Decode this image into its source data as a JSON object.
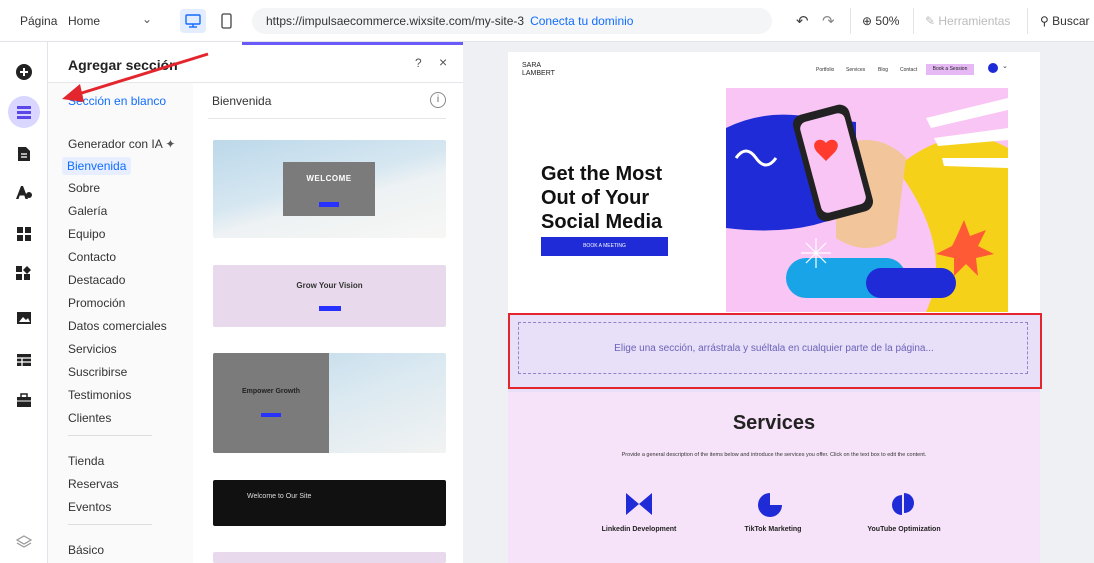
{
  "topbar": {
    "page_label": "Página",
    "page_value": "Home",
    "url": "https://impulsaecommerce.wixsite.com/my-site-3",
    "connect_domain": "Conecta tu dominio",
    "zoom": "50%",
    "tools": "Herramientas",
    "search": "Buscar"
  },
  "panel": {
    "title": "Agregar sección",
    "help": "?",
    "close": "×",
    "blank_section": "Sección en blanco",
    "categories": [
      "Generador con IA",
      "Bienvenida",
      "Sobre",
      "Galería",
      "Equipo",
      "Contacto",
      "Destacado",
      "Promoción",
      "Datos comerciales",
      "Servicios",
      "Suscribirse",
      "Testimonios",
      "Clientes"
    ],
    "categories_2": [
      "Tienda",
      "Reservas",
      "Eventos"
    ],
    "categories_3": [
      "Básico"
    ],
    "selected_category": "Bienvenida",
    "section_heading": "Bienvenida",
    "info": "i",
    "thumbnails": {
      "t1": "WELCOME",
      "t2": "Grow Your Vision",
      "t3": "Empower Growth",
      "t4": "Welcome to Our Site"
    }
  },
  "site": {
    "logo": "SARA LAMBERT",
    "nav": [
      "Portfolio",
      "Services",
      "Blog",
      "Contact"
    ],
    "nav_cta": "Book a Session",
    "hero_heading": "Get the Most Out of Your Social Media",
    "hero_button": "BOOK A MEETING",
    "drop_hint": "Elige una sección, arrástrala y suéltala en cualquier parte de la página...",
    "services_title": "Services",
    "services_desc": "Provide a general description of the items below and introduce the services you offer. Click on the text box to edit the content.",
    "services": [
      "Linkedin Development",
      "TikTok Marketing",
      "YouTube Optimization"
    ]
  },
  "colors": {
    "accent": "#116dff",
    "brand_blue": "#1f2bd6",
    "highlight_red": "#e3262d",
    "hero_pink": "#f9c5f4"
  }
}
